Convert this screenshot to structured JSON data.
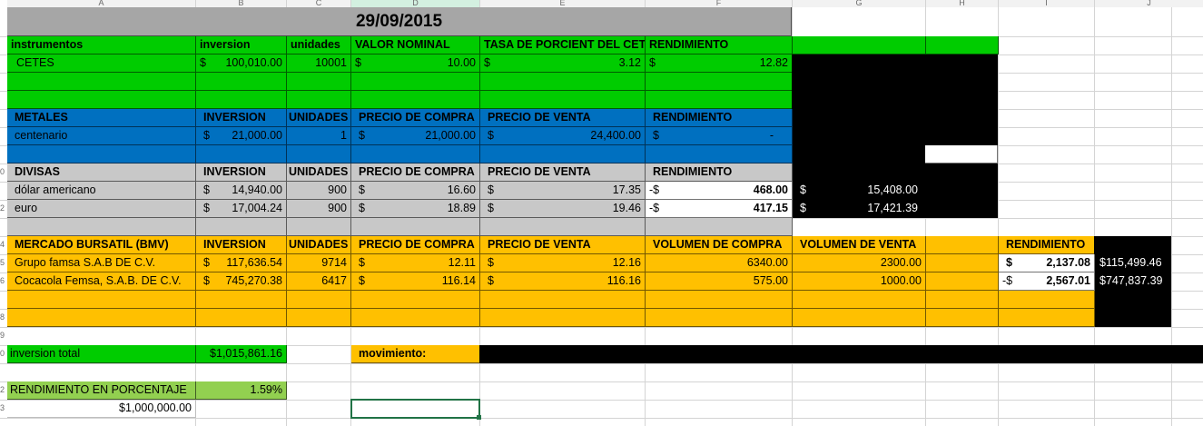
{
  "column_headers": [
    "A",
    "B",
    "C",
    "D",
    "E",
    "F",
    "G",
    "H",
    "I",
    "J"
  ],
  "row_numbers": [
    "0",
    "2",
    "4",
    "5",
    "6",
    "8",
    "9",
    "0",
    "2",
    "3"
  ],
  "date": "29/09/2015",
  "cetes": {
    "headers": [
      "instrumentos",
      "inversion",
      "unidades",
      "VALOR NOMINAL",
      "TASA DE PORCIENT DEL CETE",
      "RENDIMIENTO"
    ],
    "row": {
      "name": "CETES",
      "inversion": "100,010.00",
      "unidades": "10001",
      "valor": "10.00",
      "tasa": "3.12",
      "rendimiento": "12.82"
    }
  },
  "metales": {
    "headers": [
      "METALES",
      "INVERSION",
      "UNIDADES",
      "PRECIO DE COMPRA",
      "PRECIO DE VENTA",
      "RENDIMIENTO"
    ],
    "row": {
      "name": "centenario",
      "inversion": "21,000.00",
      "unidades": "1",
      "compra": "21,000.00",
      "venta": "24,400.00",
      "rendimiento": "-"
    }
  },
  "divisas": {
    "headers": [
      "DIVISAS",
      "INVERSION",
      "UNIDADES",
      "PRECIO DE COMPRA",
      "PRECIO DE VENTA",
      "RENDIMIENTO"
    ],
    "rows": [
      {
        "name": "dólar americano",
        "inversion": "14,940.00",
        "unidades": "900",
        "compra": "16.60",
        "venta": "17.35",
        "rend_prefix": "-$",
        "rendimiento": "468.00",
        "total": "15,408.00"
      },
      {
        "name": "euro",
        "inversion": "17,004.24",
        "unidades": "900",
        "compra": "18.89",
        "venta": "19.46",
        "rend_prefix": "-$",
        "rendimiento": "417.15",
        "total": "17,421.39"
      }
    ]
  },
  "bmv": {
    "headers": [
      "MERCADO BURSATIL (BMV)",
      "INVERSION",
      "UNIDADES",
      "PRECIO DE COMPRA",
      "PRECIO DE VENTA",
      "VOLUMEN DE COMPRA",
      "VOLUMEN DE VENTA",
      "RENDIMIENTO"
    ],
    "rows": [
      {
        "name": "Grupo famsa S.A.B DE C.V.",
        "inversion": "117,636.54",
        "unidades": "9714",
        "compra": "12.11",
        "venta": "12.16",
        "vol_compra": "6340.00",
        "vol_venta": "2300.00",
        "rend_prefix": "$",
        "rendimiento": "2,137.08",
        "total": "$115,499.46"
      },
      {
        "name": "Cocacola Femsa, S.A.B. DE C.V.",
        "inversion": "745,270.38",
        "unidades": "6417",
        "compra": "116.14",
        "venta": "116.16",
        "vol_compra": "575.00",
        "vol_venta": "1000.00",
        "rend_prefix": "-$",
        "rendimiento": "2,567.01",
        "total": "$747,837.39"
      }
    ]
  },
  "summary": {
    "inversion_label": "inversion total",
    "inversion_value": "$1,015,861.16",
    "movimiento_label": "movimiento:",
    "rendimiento_label": "RENDIMIENTO EN PORCENTAJE",
    "rendimiento_value": "1.59%",
    "base_value": "$1,000,000.00"
  },
  "currency_symbol": "$",
  "colors": {
    "green": "#00cc00",
    "blue": "#0070c0",
    "gray": "#c8c8c8",
    "orange": "#ffc000",
    "black": "#000000",
    "light_green": "#92d050"
  }
}
